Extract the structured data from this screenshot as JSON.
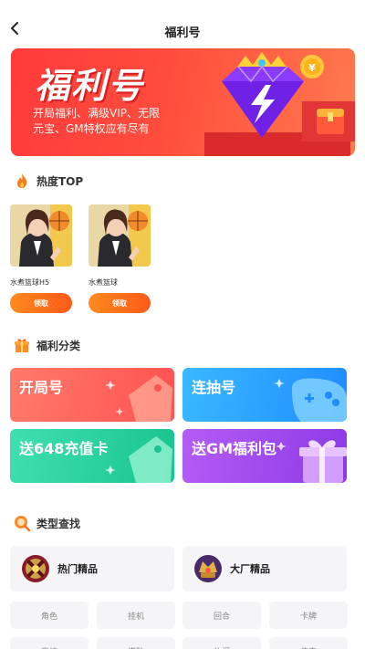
{
  "header": {
    "title": "福利号",
    "back_icon": "chevron-left-icon"
  },
  "banner": {
    "title": "福利号",
    "desc_line1": "开局福利、满级VIP、无限",
    "desc_line2": "元宝、GM特权应有尽有"
  },
  "hot": {
    "title": "热度TOP",
    "icon": "flame-icon",
    "games": [
      {
        "name": "水煮篮球H5",
        "button": "领取"
      },
      {
        "name": "水煮篮球",
        "button": "领取"
      }
    ]
  },
  "categories": {
    "title": "福利分类",
    "icon": "gift-icon",
    "items": [
      {
        "label": "开局号",
        "color": "#ff6b6b"
      },
      {
        "label": "连抽号",
        "color": "#2fa4ff"
      },
      {
        "label": "送648充值卡",
        "color": "#2ed3a0"
      },
      {
        "label": "送GM福利包",
        "color": "#a64cf0"
      }
    ]
  },
  "types": {
    "title": "类型查找",
    "icon": "search-icon",
    "cards": [
      {
        "label": "热门精品"
      },
      {
        "label": "大厂精品"
      }
    ],
    "tags_row1": [
      "角色",
      "挂机",
      "回合",
      "卡牌"
    ],
    "tags_row2": [
      "竞技",
      "塔防",
      "休闲",
      "传奇"
    ]
  }
}
